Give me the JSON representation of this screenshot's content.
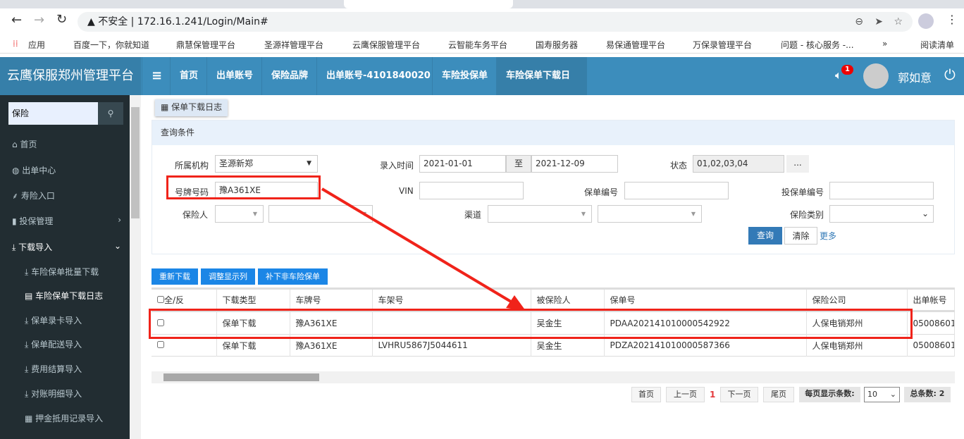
{
  "browser": {
    "security": "不安全",
    "url": "172.16.1.241/Login/Main#",
    "bookmarks": [
      "应用",
      "百度一下，你就知道",
      "鼎慧保管理平台",
      "圣源祥管理平台",
      "云鹰保服管理平台",
      "云智能车务平台",
      "国寿服务器",
      "易保通管理平台",
      "万保录管理平台",
      "问题 - 核心服务 -...",
      "»",
      "阅读清单"
    ]
  },
  "header": {
    "brand": "云鹰保服郑州管理平台",
    "menu_icon": "≡",
    "nav": [
      "首页",
      "出单账号",
      "保险品牌",
      "出单账号-4101840020",
      "车险投保单",
      "车险保单下载日志"
    ],
    "badge": "1",
    "user": "郭如意"
  },
  "sidebar": {
    "search": "保险",
    "items": [
      "首页",
      "出单中心",
      "寿险入口",
      "投保管理",
      "下载导入"
    ],
    "subitems": [
      "车险保单批量下载",
      "车险保单下载日志",
      "保单录卡导入",
      "保单配送导入",
      "费用结算导入",
      "对账明细导入",
      "押金抵用记录导入"
    ]
  },
  "page": {
    "tab": "保单下载日志",
    "panel_title": "查询条件",
    "labels": {
      "org": "所属机构",
      "time": "录入时间",
      "to": "至",
      "status": "状态",
      "plate": "号牌号码",
      "vin": "VIN",
      "policy_no": "保单编号",
      "proposal_no": "投保单编号",
      "insured": "保险人",
      "channel": "渠道",
      "type": "保险类别"
    },
    "values": {
      "org": "圣源新郑",
      "start": "2021-01-01",
      "end": "2021-12-09",
      "status": "01,02,03,04",
      "plate": "豫A361XE",
      "more_btn": "..."
    },
    "buttons": {
      "query": "查询",
      "clear": "清除",
      "more": "更多",
      "redownload": "重新下载",
      "adjust": "调整显示列",
      "supplement": "补下非车险保单"
    }
  },
  "table": {
    "headers": [
      "全/反",
      "下载类型",
      "车牌号",
      "车架号",
      "被保险人",
      "保单号",
      "保险公司",
      "出单帐号"
    ],
    "rows": [
      [
        "保单下载",
        "豫A361XE",
        "",
        "吴金生",
        "PDAA202141010000542922",
        "人保电销郑州",
        "05008601"
      ],
      [
        "保单下载",
        "豫A361XE",
        "LVHRU5867J5044611",
        "吴金生",
        "PDZA202141010000587366",
        "人保电销郑州",
        "05008601"
      ]
    ]
  },
  "pager": {
    "first": "首页",
    "prev": "上一页",
    "current": "1",
    "next": "下一页",
    "last": "尾页",
    "size_label": "每页显示条数:",
    "size": "10",
    "total": "总条数: 2"
  }
}
